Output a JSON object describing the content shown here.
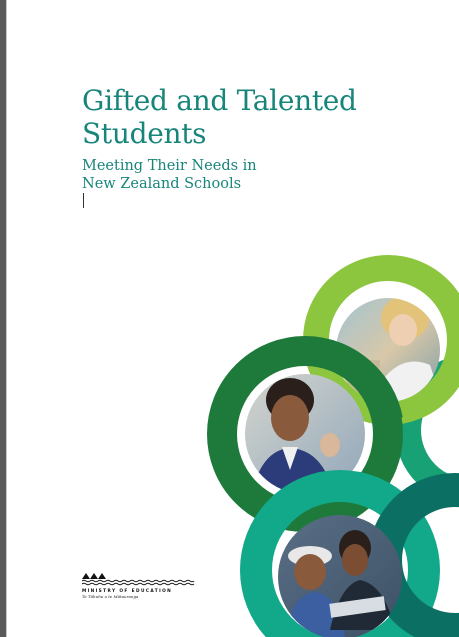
{
  "cover": {
    "title_line1": "Gifted and Talented",
    "title_line2": "Students",
    "subtitle_line1": "Meeting Their Needs in",
    "subtitle_line2": "New Zealand Schools"
  },
  "logo": {
    "name": "MINISTRY OF EDUCATION",
    "tagline": "Te Tāhuhu o te Mātauranga"
  },
  "colors": {
    "title": "#17857a",
    "ring_lime": "#8cc63f",
    "ring_dark_green": "#1e7a3a",
    "ring_teal": "#12a88a",
    "ring_deep_teal": "#0c6f63"
  },
  "images": {
    "photo_top": "student-with-teacher-photo",
    "photo_middle": "boy-in-uniform-photo",
    "photo_bottom": "students-at-laptop-photo"
  }
}
